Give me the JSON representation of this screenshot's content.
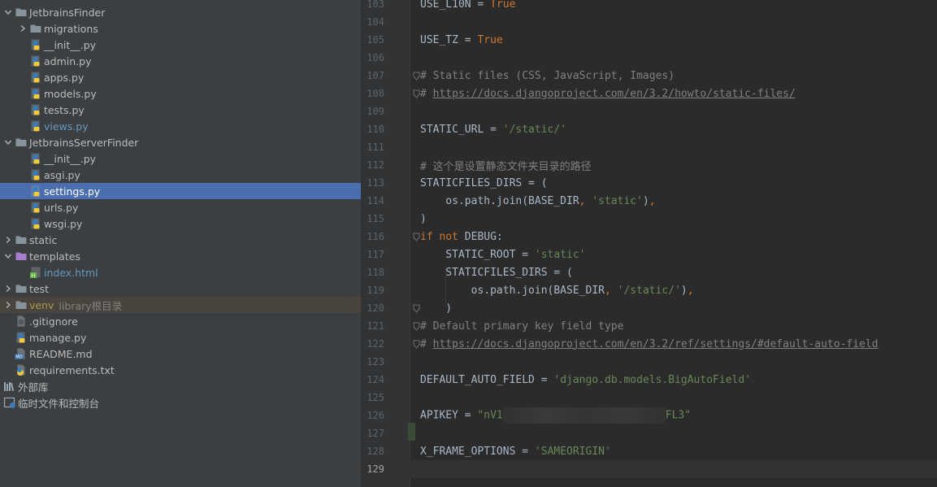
{
  "project_tree": {
    "rows": [
      {
        "label": "JetbrainsFinder",
        "depth": 0,
        "expanded": true,
        "icon": "folder-icon"
      },
      {
        "label": "migrations",
        "depth": 1,
        "expanded": false,
        "icon": "folder-icon"
      },
      {
        "label": "__init__.py",
        "depth": 1,
        "icon": "python-file-icon"
      },
      {
        "label": "admin.py",
        "depth": 1,
        "icon": "python-file-icon"
      },
      {
        "label": "apps.py",
        "depth": 1,
        "icon": "python-file-icon"
      },
      {
        "label": "models.py",
        "depth": 1,
        "icon": "python-file-icon"
      },
      {
        "label": "tests.py",
        "depth": 1,
        "icon": "python-file-icon"
      },
      {
        "label": "views.py",
        "depth": 1,
        "icon": "python-file-icon",
        "modified": true
      },
      {
        "label": "JetbrainsServerFinder",
        "depth": 0,
        "expanded": true,
        "icon": "folder-icon"
      },
      {
        "label": "__init__.py",
        "depth": 1,
        "icon": "python-file-icon"
      },
      {
        "label": "asgi.py",
        "depth": 1,
        "icon": "python-file-icon"
      },
      {
        "label": "settings.py",
        "depth": 1,
        "icon": "python-file-icon",
        "selected": true
      },
      {
        "label": "urls.py",
        "depth": 1,
        "icon": "python-file-icon"
      },
      {
        "label": "wsgi.py",
        "depth": 1,
        "icon": "python-file-icon"
      },
      {
        "label": "static",
        "depth": 0,
        "expanded": false,
        "icon": "folder-icon"
      },
      {
        "label": "templates",
        "depth": 0,
        "expanded": true,
        "icon": "templates-folder-icon"
      },
      {
        "label": "index.html",
        "depth": 1,
        "icon": "html-file-icon",
        "modified": true
      },
      {
        "label": "test",
        "depth": 0,
        "expanded": false,
        "icon": "folder-icon"
      },
      {
        "label": "venv",
        "hint": "library根目录",
        "depth": 0,
        "expanded": false,
        "icon": "folder-icon",
        "excluded": true
      },
      {
        "label": ".gitignore",
        "depth": 0,
        "icon": "text-file-icon"
      },
      {
        "label": "manage.py",
        "depth": 0,
        "icon": "python-file-icon"
      },
      {
        "label": "README.md",
        "depth": 0,
        "icon": "markdown-file-icon"
      },
      {
        "label": "requirements.txt",
        "depth": 0,
        "icon": "requirements-file-icon"
      },
      {
        "label": "外部库",
        "depth": -1,
        "icon": "library-icon"
      },
      {
        "label": "临时文件和控制台",
        "depth": -1,
        "icon": "scratches-icon"
      }
    ]
  },
  "editor": {
    "current_line": 129,
    "lines": [
      {
        "n": "103",
        "tokens": [
          [
            "",
            "USE_L10N = "
          ],
          [
            "kw",
            "True"
          ]
        ]
      },
      {
        "n": "104",
        "tokens": []
      },
      {
        "n": "105",
        "tokens": [
          [
            "",
            "USE_TZ = "
          ],
          [
            "kw",
            "True"
          ]
        ]
      },
      {
        "n": "106",
        "tokens": []
      },
      {
        "n": "107",
        "fold": true,
        "tokens": [
          [
            "cm",
            "# Static files (CSS, JavaScript, Images)"
          ]
        ]
      },
      {
        "n": "108",
        "fold": true,
        "tokens": [
          [
            "cm",
            "# "
          ],
          [
            "link",
            "https://docs.djangoproject.com/en/3.2/howto/static-files/"
          ]
        ]
      },
      {
        "n": "109",
        "tokens": []
      },
      {
        "n": "110",
        "tokens": [
          [
            "",
            "STATIC_URL = "
          ],
          [
            "str",
            "'/static/'"
          ]
        ]
      },
      {
        "n": "111",
        "tokens": []
      },
      {
        "n": "112",
        "tokens": [
          [
            "cm",
            "# 这个是设置静态文件夹目录的路径"
          ]
        ]
      },
      {
        "n": "113",
        "tokens": [
          [
            "",
            "STATICFILES_DIRS = ("
          ]
        ]
      },
      {
        "n": "114",
        "tokens": [
          [
            "",
            "    os.path.join(BASE_DIR"
          ],
          [
            "kw",
            ", "
          ],
          [
            "str",
            "'static'"
          ],
          [
            "",
            ")"
          ],
          [
            "kw",
            ","
          ]
        ]
      },
      {
        "n": "115",
        "tokens": [
          [
            "",
            ")"
          ]
        ]
      },
      {
        "n": "116",
        "fold": true,
        "tokens": [
          [
            "kw",
            "if not "
          ],
          [
            "",
            "DEBUG:"
          ]
        ]
      },
      {
        "n": "117",
        "tokens": [
          [
            "",
            "    STATIC_ROOT = "
          ],
          [
            "str",
            "'static'"
          ]
        ]
      },
      {
        "n": "118",
        "tokens": [
          [
            "",
            "    STATICFILES_DIRS = ("
          ]
        ]
      },
      {
        "n": "119",
        "tokens": [
          [
            "",
            "        os.path.join(BASE_DIR"
          ],
          [
            "kw",
            ", "
          ],
          [
            "str",
            "'/static/'"
          ],
          [
            "",
            ")"
          ],
          [
            "kw",
            ","
          ]
        ]
      },
      {
        "n": "120",
        "fold": true,
        "tokens": [
          [
            "",
            "    )"
          ]
        ]
      },
      {
        "n": "121",
        "fold": true,
        "tokens": [
          [
            "cm",
            "# Default primary key field type"
          ]
        ]
      },
      {
        "n": "122",
        "fold": true,
        "tokens": [
          [
            "cm",
            "# "
          ],
          [
            "link",
            "https://docs.djangoproject.com/en/3.2/ref/settings/#default-auto-field"
          ]
        ]
      },
      {
        "n": "123",
        "tokens": []
      },
      {
        "n": "124",
        "tokens": [
          [
            "",
            "DEFAULT_AUTO_FIELD = "
          ],
          [
            "str",
            "'django.db.models.BigAutoField'"
          ]
        ]
      },
      {
        "n": "125",
        "tokens": []
      },
      {
        "n": "126",
        "tokens": [
          [
            "",
            "APIKEY = "
          ],
          [
            "str",
            "\"nV1"
          ],
          [
            "blur",
            ""
          ],
          [
            "str",
            "FL3\""
          ]
        ]
      },
      {
        "n": "127",
        "tokens": []
      },
      {
        "n": "128",
        "tokens": [
          [
            "",
            "X_FRAME_OPTIONS = "
          ],
          [
            "str",
            "'SAMEORIGIN'"
          ]
        ]
      },
      {
        "n": "129",
        "tokens": []
      }
    ]
  },
  "colors": {
    "tree_bg": "#3c3f41",
    "editor_bg": "#2b2b2b",
    "selection": "#4b6eaf",
    "keyword": "#cc7832",
    "string": "#6a8759",
    "comment": "#808080"
  }
}
